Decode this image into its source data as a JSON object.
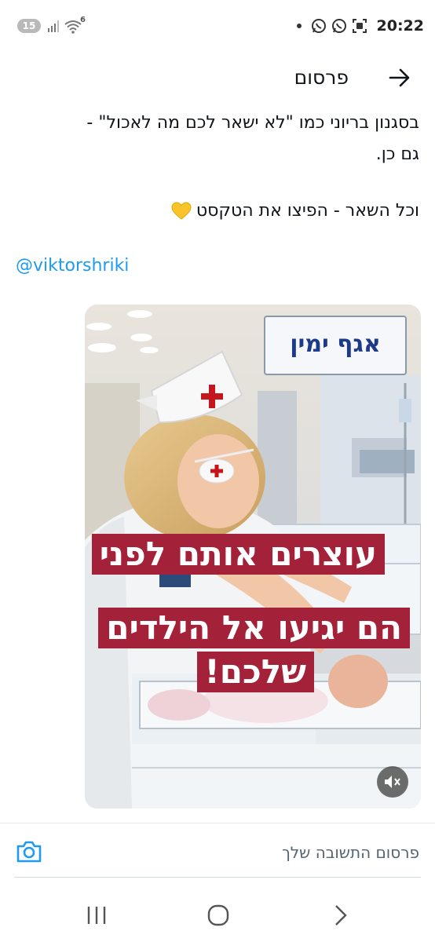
{
  "status_bar": {
    "notification_count": "15",
    "wifi_badge": "6",
    "time": "20:22",
    "icons": [
      "signal-icon",
      "wifi-icon",
      "dot-icon",
      "whatsapp-icon",
      "whatsapp-icon",
      "screenshot-icon"
    ]
  },
  "header": {
    "title": "פרסום",
    "back_icon": "arrow-right-icon"
  },
  "post": {
    "line1": "בסגנון בריוני כמו \"לא ישאר לכם מה לאכול\" -",
    "line2": "גם כן.",
    "line3": "וכל השאר - הפיצו את הטקסט",
    "heart_icon": "yellow-heart-icon",
    "mention": "@viktorshriki"
  },
  "media": {
    "sign_text": "אגף ימין",
    "caption1": "עוצרים אותם לפני",
    "caption2": "הם יגיעו אל הילדים",
    "caption3": "שלכם!",
    "mute_icon": "volume-muted-icon"
  },
  "reply": {
    "placeholder": "פרסום התשובה שלך",
    "camera_icon": "camera-icon"
  },
  "nav": {
    "recent_icon": "recent-apps-icon",
    "home_icon": "home-icon",
    "back_icon": "chevron-right-icon"
  },
  "colors": {
    "accent": "#1d9bf0",
    "caption_bg": "#a3223a",
    "text": "#0f1419",
    "muted": "#536471"
  }
}
